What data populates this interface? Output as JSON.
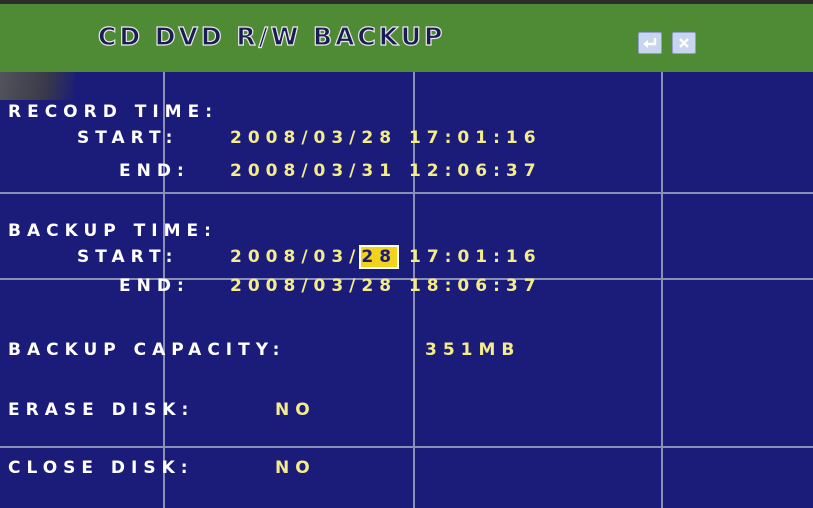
{
  "window": {
    "title": "CD DVD R/W BACKUP",
    "buttons": [
      {
        "name": "return-button",
        "icon": "return-arrow-icon"
      },
      {
        "name": "close-button",
        "icon": "close-x-icon"
      }
    ]
  },
  "record_time": {
    "label": "RECORD TIME:",
    "start_label": "START:",
    "start_value": "2008/03/28 17:01:16",
    "end_label": "END:",
    "end_value": "2008/03/31 12:06:37"
  },
  "backup_time": {
    "label": "BACKUP TIME:",
    "start_label": "START:",
    "start_date_prefix": "2008/03/",
    "start_day_selected": "28",
    "start_time": "17:01:16",
    "end_label": "END:",
    "end_value": "2008/03/28 18:06:37"
  },
  "backup_capacity": {
    "label": "BACKUP CAPACITY:",
    "value": "351MB"
  },
  "erase_disk": {
    "label": "ERASE DISK:",
    "value": "NO"
  },
  "close_disk": {
    "label": "CLOSE DISK:",
    "value": "NO"
  },
  "colors": {
    "background": "#1b1c79",
    "titlebar": "#4f8a35",
    "label_text": "#ffffff",
    "value_text": "#f4ec8a",
    "highlight": "#f3d21a"
  }
}
